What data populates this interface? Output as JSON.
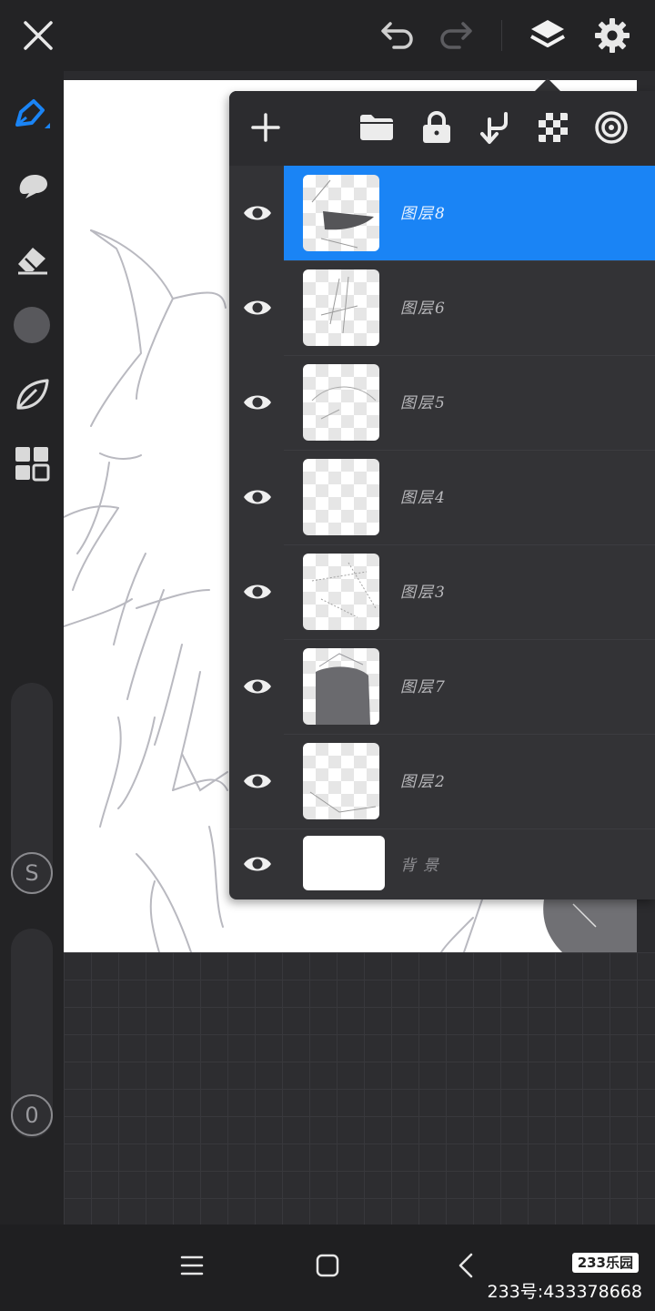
{
  "layers": [
    {
      "name": "图层8",
      "active": true
    },
    {
      "name": "图层6",
      "active": false
    },
    {
      "name": "图层5",
      "active": false
    },
    {
      "name": "图层4",
      "active": false
    },
    {
      "name": "图层3",
      "active": false
    },
    {
      "name": "图层7",
      "active": false
    },
    {
      "name": "图层2",
      "active": false
    },
    {
      "name": "背景",
      "active": false
    }
  ],
  "sliders": {
    "size_label": "S",
    "opacity_label": "0"
  },
  "colors": {
    "accent": "#1a84f5",
    "panel": "#333336",
    "toolbar": "#232325"
  },
  "icons": {
    "top": [
      "close-icon",
      "undo-icon",
      "redo-icon",
      "layers-icon",
      "settings-icon"
    ],
    "tools": [
      "pen-icon",
      "smudge-icon",
      "eraser-icon",
      "color-swatch",
      "leaf-icon",
      "grid-icon"
    ],
    "panel": [
      "add-icon",
      "folder-icon",
      "lock-icon",
      "merge-down-icon",
      "transparency-icon",
      "target-icon"
    ]
  },
  "watermark": {
    "brand": "233乐园",
    "id": "233号:433378668"
  }
}
